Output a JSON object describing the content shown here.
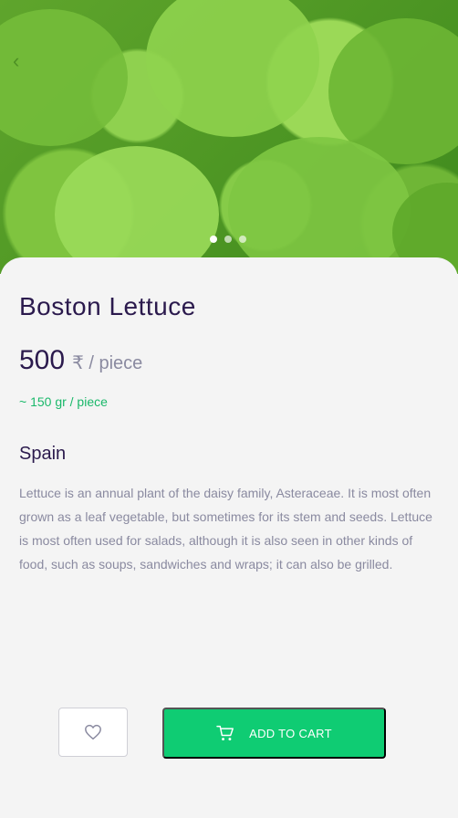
{
  "product": {
    "title": "Boston Lettuce",
    "price": "500",
    "unit": "₹ / piece",
    "weight": "~ 150 gr / piece",
    "origin": "Spain",
    "description": "Lettuce is an annual plant of the daisy family, Asteraceae. It is most often grown as a leaf vegetable, but sometimes for its stem and seeds. Lettuce is most often used for salads, although it is also seen in other kinds of food, such as soups, sandwiches and wraps; it can also be grilled."
  },
  "carousel": {
    "dots": 3,
    "active": 0
  },
  "actions": {
    "cart_label": "ADD TO CART",
    "favorite_icon": "heart-icon",
    "cart_icon": "cart-icon"
  },
  "colors": {
    "primary_green": "#0fcc73",
    "title_purple": "#2b1a4d",
    "muted_text": "#8a8aa0",
    "weight_green": "#1ab86a"
  }
}
